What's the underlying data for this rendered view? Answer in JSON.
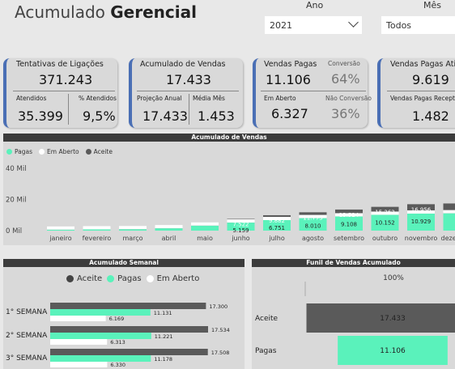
{
  "header": {
    "title_light": "Acumulado",
    "title_bold": "Gerencial",
    "ano_label": "Ano",
    "ano_value": "2021",
    "mes_label": "Mês",
    "mes_value": "Todos"
  },
  "cards": {
    "ligacoes": {
      "title": "Tentativas de Ligações",
      "value": "371.243",
      "sub1_label": "Atendidos",
      "sub1_value": "35.399",
      "sub2_label": "% Atendidos",
      "sub2_value": "9,5%"
    },
    "vendas": {
      "title": "Acumulado de Vendas",
      "value": "17.433",
      "sub1_label": "Projeção Anual",
      "sub1_value": "17.433",
      "sub2_label": "Média Mês",
      "sub2_value": "1.453"
    },
    "pagas": {
      "title": "Vendas Pagas",
      "value": "11.106",
      "conv_label": "Conversão",
      "conv_value": "64%",
      "aberto_label": "Em Aberto",
      "aberto_value": "6.327",
      "nconv_label": "Não Conversão",
      "nconv_value": "36%"
    },
    "ativo": {
      "title": "Vendas Pagas Ativo",
      "value": "9.619",
      "sub_label": "Vendas Pagas Recept",
      "sub_value": "1.482"
    }
  },
  "chart_data": [
    {
      "type": "bar",
      "title": "Acumulado de Vendas",
      "categories": [
        "janeiro",
        "fevereiro",
        "março",
        "abril",
        "maio",
        "junho",
        "julho",
        "agosto",
        "setembro",
        "outubro",
        "novembro",
        "dezembro"
      ],
      "series": [
        {
          "name": "Pagas",
          "color": "#5af2bb",
          "values": [
            600,
            800,
            900,
            1500,
            3200,
            5159,
            6751,
            8010,
            9108,
            10152,
            10929,
            11106
          ]
        },
        {
          "name": "Em Aberto",
          "color": "#ffffff",
          "values": [
            600,
            700,
            800,
            1200,
            1700,
            2363,
            3131,
            3763,
            4416,
            5110,
            6027,
            6327
          ]
        },
        {
          "name": "Aceite",
          "color": "#5a5a5a",
          "values": [
            1200,
            1500,
            1700,
            2700,
            4900,
            7522,
            9882,
            11773,
            13524,
            15262,
            16956,
            17433
          ]
        }
      ],
      "labels_shown": {
        "Pagas": [
          null,
          null,
          null,
          null,
          null,
          "5.159",
          "6.751",
          "8.010",
          "9.108",
          "10.152",
          "10.929",
          null
        ],
        "Aceite": [
          null,
          null,
          null,
          null,
          null,
          "7.522",
          "9.882",
          "11.773",
          "13.524",
          "15.262",
          "16.956",
          null
        ]
      },
      "yticks": [
        "0 Mil",
        "20 Mil",
        "40 Mil"
      ],
      "ylim": [
        0,
        40000
      ],
      "legend_position": "top-left"
    },
    {
      "type": "bar",
      "orientation": "horizontal",
      "title": "Acumulado Semanal",
      "categories": [
        "1° SEMANA",
        "2° SEMANA",
        "3° SEMANA"
      ],
      "series": [
        {
          "name": "Aceite",
          "color": "#5a5a5a",
          "values": [
            17300,
            17534,
            17508
          ],
          "labels": [
            "17.300",
            "17.534",
            "17.508"
          ]
        },
        {
          "name": "Pagas",
          "color": "#5af2bb",
          "values": [
            11131,
            11221,
            11178
          ],
          "labels": [
            "11.131",
            "11.221",
            "11.178"
          ]
        },
        {
          "name": "Em Aberto",
          "color": "#ffffff",
          "values": [
            6169,
            6313,
            6330
          ],
          "labels": [
            "6.169",
            "6.313",
            "6.330"
          ]
        }
      ],
      "legend_position": "top-center"
    },
    {
      "type": "bar",
      "orientation": "funnel",
      "title": "Funil de Vendas Acumulado",
      "top_label": "100%",
      "categories": [
        "Aceite",
        "Pagas"
      ],
      "values": [
        17433,
        11106
      ],
      "labels": [
        "17.433",
        "11.106"
      ],
      "colors": [
        "#5a5a5a",
        "#5af2bb"
      ]
    }
  ]
}
